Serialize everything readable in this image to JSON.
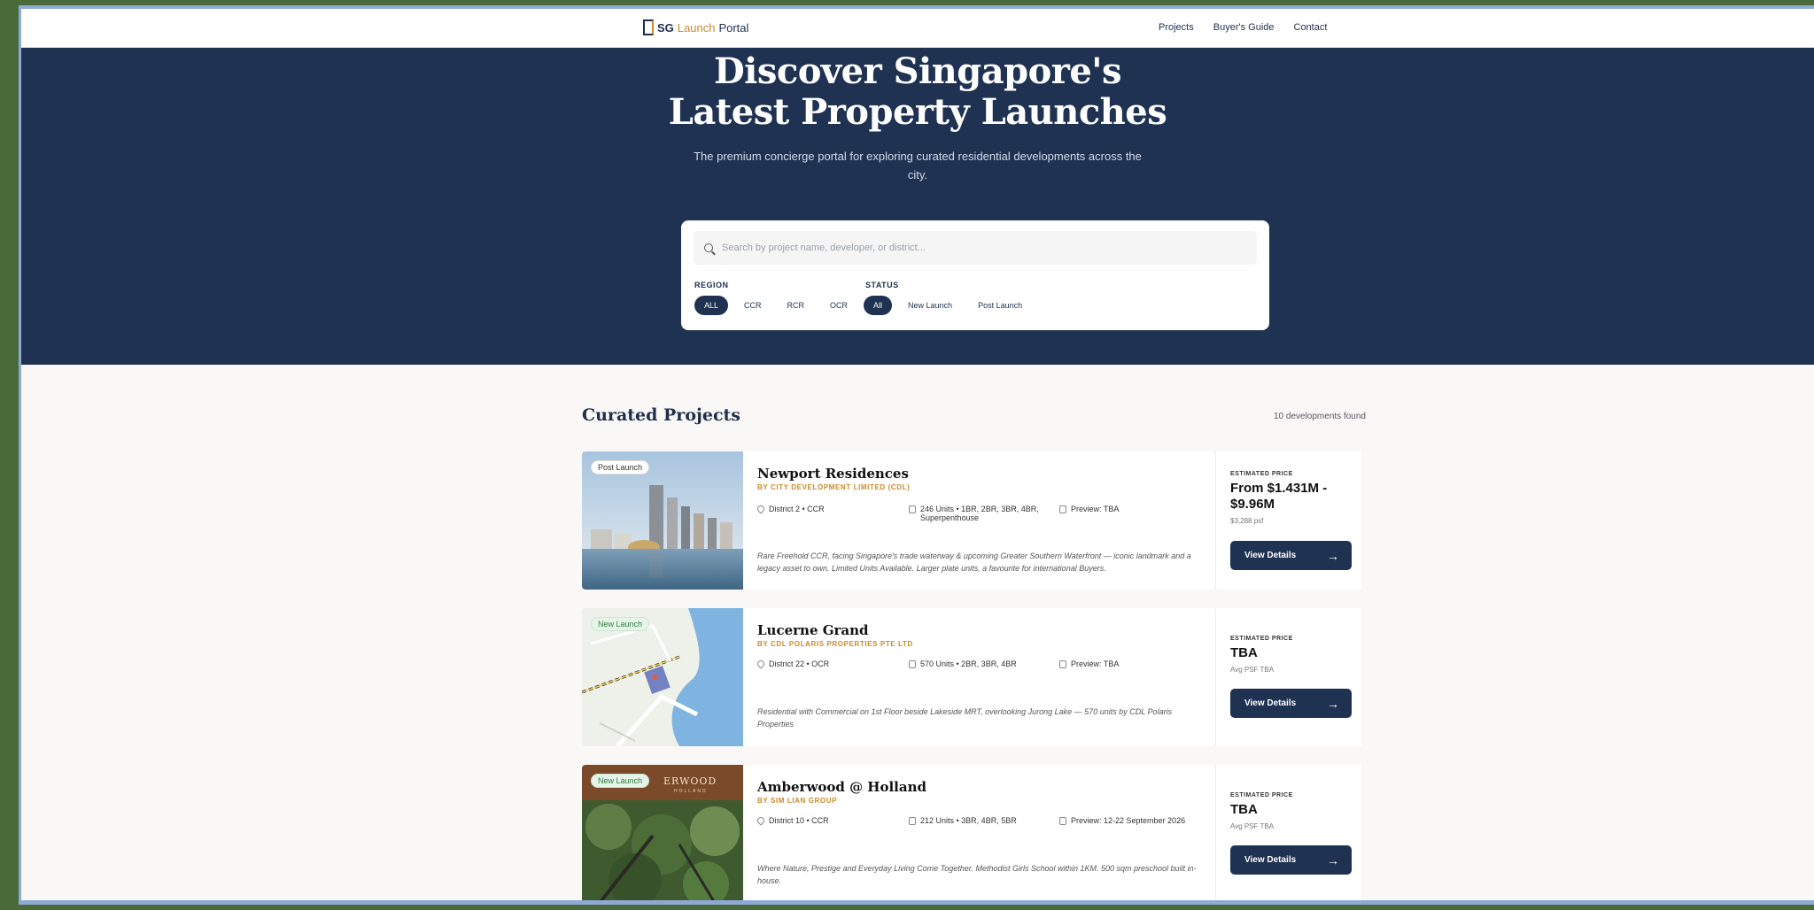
{
  "nav": {
    "logo_sg": "SG",
    "logo_launch": "Launch",
    "logo_portal": "Portal",
    "links": [
      "Projects",
      "Buyer's Guide",
      "Contact"
    ]
  },
  "hero": {
    "title_line1": "Discover Singapore's",
    "title_line2": "Latest Property Launches",
    "subtitle": "The premium concierge portal for exploring curated residential developments across the city."
  },
  "search": {
    "placeholder": "Search by project name, developer, or district...",
    "region_label": "REGION",
    "region_options": [
      "ALL",
      "CCR",
      "RCR",
      "OCR"
    ],
    "region_selected": "ALL",
    "status_label": "STATUS",
    "status_options": [
      "All",
      "New Launch",
      "Post Launch"
    ],
    "status_selected": "All"
  },
  "section": {
    "title": "Curated Projects",
    "count": "10 developments found"
  },
  "projects": [
    {
      "badge": "Post Launch",
      "name": "Newport Residences",
      "developer": "BY CITY DEVELOPMENT LIMITED (CDL)",
      "district": "District 2 • CCR",
      "units": "246 Units • 1BR, 2BR, 3BR, 4BR, Superpenthouse",
      "preview": "Preview: TBA",
      "description": "Rare Freehold CCR, facing Singapore's trade waterway & upcoming Greater Southern Waterfront — iconic landmark and a legacy asset to own. Limited Units Available. Larger plate units, a favourite for international Buyers.",
      "price_label": "ESTIMATED PRICE",
      "price": "From $1.431M - $9.96M",
      "psf": "$3,288 psf",
      "button": "View Details"
    },
    {
      "badge": "New Launch",
      "name": "Lucerne Grand",
      "developer": "BY CDL POLARIS PROPERTIES PTE LTD",
      "district": "District 22 • OCR",
      "units": "570 Units • 2BR, 3BR, 4BR",
      "preview": "Preview: TBA",
      "description": "Residential with Commercial on 1st Floor beside Lakeside MRT, overlooking Jurong Lake — 570 units by CDL Polaris Properties",
      "price_label": "ESTIMATED PRICE",
      "price": "TBA",
      "psf": "Avg PSF TBA",
      "button": "View Details"
    },
    {
      "badge": "New Launch",
      "name": "Amberwood @ Holland",
      "developer": "BY SIM LIAN GROUP",
      "district": "District 10 • CCR",
      "units": "212 Units • 3BR, 4BR, 5BR",
      "preview": "Preview: 12-22 September 2026",
      "description": "Where Nature, Prestige and Everyday Living Come Together. Methodist Girls School within 1KM. 500 sqm preschool built in-house.",
      "price_label": "ESTIMATED PRICE",
      "price": "TBA",
      "psf": "Avg PSF TBA",
      "button": "View Details",
      "image_text": "ERWOOD",
      "image_subtext": "HOLLAND"
    }
  ],
  "colors": {
    "navy": "#1f3252",
    "gold": "#c98a2b",
    "page_bg": "#faf8f6"
  }
}
